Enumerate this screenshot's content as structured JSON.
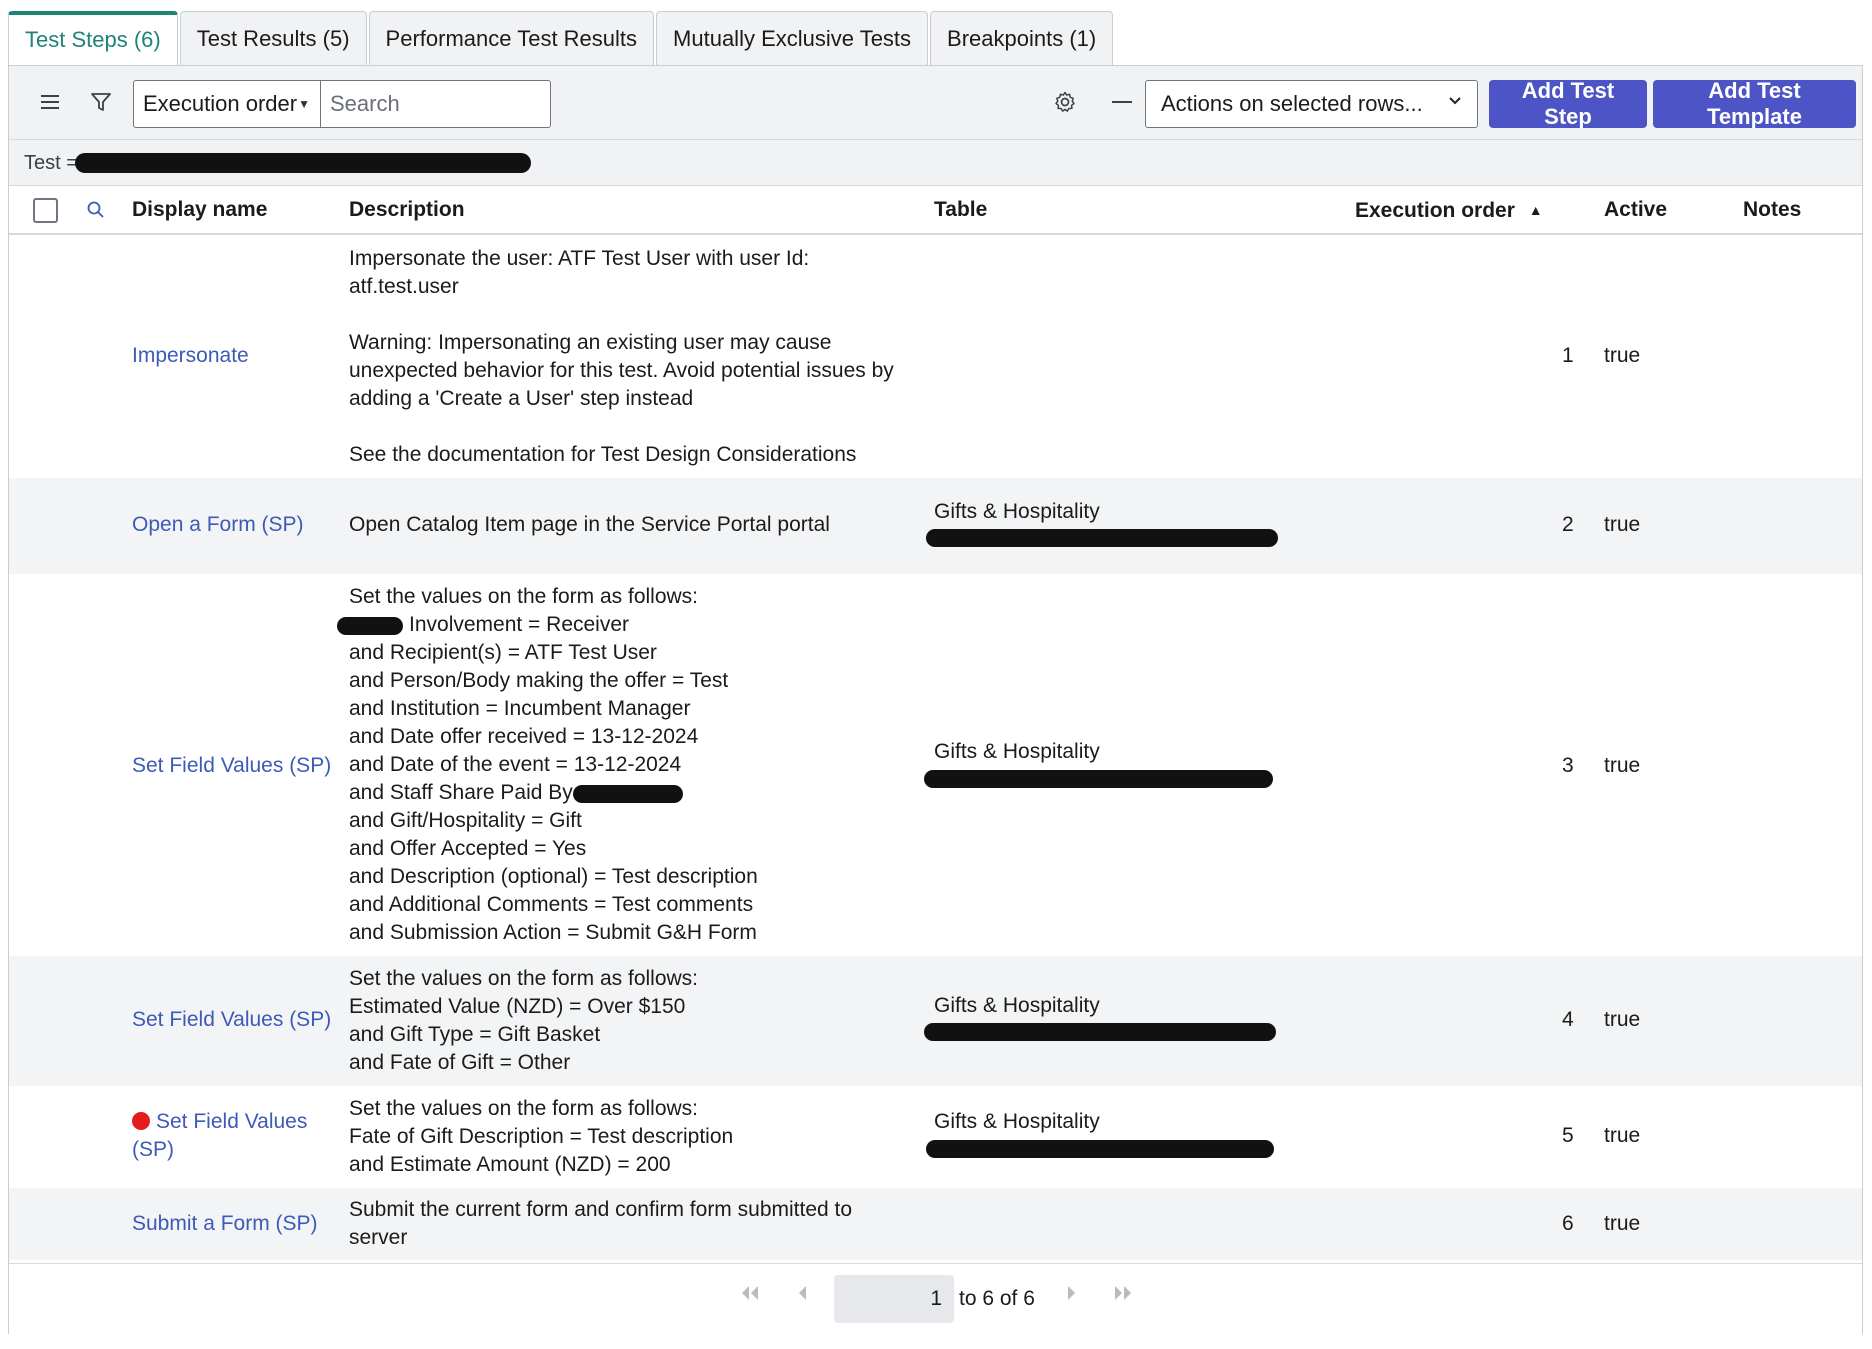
{
  "tabs": [
    {
      "label": "Test Steps (6)"
    },
    {
      "label": "Test Results (5)"
    },
    {
      "label": "Performance Test Results"
    },
    {
      "label": "Mutually Exclusive Tests"
    },
    {
      "label": "Breakpoints (1)"
    }
  ],
  "toolbar": {
    "order_select": "Execution order",
    "search_placeholder": "Search",
    "actions_select": "Actions on selected rows...",
    "add_step": "Add Test Step",
    "add_template": "Add Test Template"
  },
  "breadcrumb": {
    "label": "Test ="
  },
  "columns": {
    "display_name": "Display name",
    "description": "Description",
    "table": "Table",
    "execution_order": "Execution order",
    "active": "Active",
    "notes": "Notes"
  },
  "rows": [
    {
      "name": "Impersonate",
      "description": "Impersonate the user: ATF Test User with user Id:\natf.test.user\n\nWarning: Impersonating an existing user may cause\nunexpected behavior for this test. Avoid potential issues by\nadding a 'Create a User' step instead\n\nSee the documentation for Test Design Considerations",
      "table": "",
      "order": "1",
      "active": "true"
    },
    {
      "name": "Open a Form (SP)",
      "description": "Open Catalog Item page in the Service Portal portal",
      "table": "Gifts & Hospitality",
      "order": "2",
      "active": "true"
    },
    {
      "name": "Set Field Values (SP)",
      "desc_line1": "Set the values on the form as follows:",
      "desc_line2": "Involvement = Receiver",
      "desc_middle": "and Recipient(s) = ATF Test User\nand Person/Body making the offer = Test\nand Institution = Incumbent Manager\nand Date offer received = 13-12-2024\nand Date of the event = 13-12-2024",
      "desc_staff": "and Staff Share Paid By =",
      "desc_rest": "and Gift/Hospitality = Gift\nand Offer Accepted = Yes\nand Description (optional) = Test description\nand Additional Comments = Test comments\nand Submission Action = Submit G&H Form",
      "table": "Gifts & Hospitality",
      "order": "3",
      "active": "true"
    },
    {
      "name": "Set Field Values (SP)",
      "description": "Set the values on the form as follows:\nEstimated Value (NZD) = Over $150\nand Gift Type = Gift Basket\nand Fate of Gift = Other",
      "table": "Gifts & Hospitality",
      "order": "4",
      "active": "true"
    },
    {
      "name": "Set Field Values (SP)",
      "description": "Set the values on the form as follows:\nFate of Gift Description = Test description\nand Estimate Amount (NZD) = 200",
      "table": "Gifts & Hospitality",
      "order": "5",
      "active": "true"
    },
    {
      "name": "Submit a Form (SP)",
      "description": "Submit the current form and confirm form submitted to\nserver",
      "table": "",
      "order": "6",
      "active": "true"
    }
  ],
  "pager": {
    "page": "1",
    "range": "to 6 of 6"
  },
  "colors": {
    "accent": "#1f8476",
    "primary_button": "#4d54c5",
    "link": "#3d5ab8",
    "breakpoint": "#e51c1c"
  }
}
